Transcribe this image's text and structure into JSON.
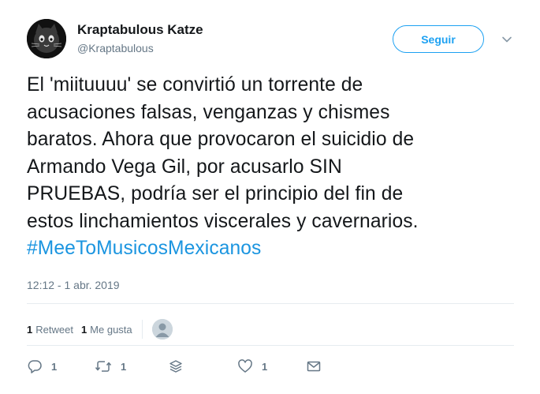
{
  "author": {
    "display_name": "Kraptabulous Katze",
    "handle": "@Kraptabulous",
    "avatar_icon": "cat-face-avatar"
  },
  "follow_button": {
    "label": "Seguir"
  },
  "menu": {
    "icon": "chevron-down-icon"
  },
  "tweet": {
    "lines": [
      "El 'miituuuu' se convirtió un torrente de",
      "acusaciones falsas, venganzas y chismes",
      "baratos. Ahora que provocaron el suicidio de",
      "Armando Vega Gil, por acusarlo SIN",
      "PRUEBAS, podría ser el principio del fin de",
      "estos linchamientos viscerales y cavernarios."
    ],
    "hashtag": "#MeeToMusicosMexicanos",
    "timestamp": "12:12 - 1 abr. 2019"
  },
  "stats": {
    "retweets_count": "1",
    "retweets_label": "Retweet",
    "likes_count": "1",
    "likes_label": "Me gusta"
  },
  "actions": {
    "reply_count": "1",
    "retweet_count": "1",
    "like_count": "1"
  },
  "colors": {
    "accent": "#1da1f2",
    "hashtag": "#1b95e0",
    "muted": "#657786",
    "divider": "#e6ecf0"
  }
}
